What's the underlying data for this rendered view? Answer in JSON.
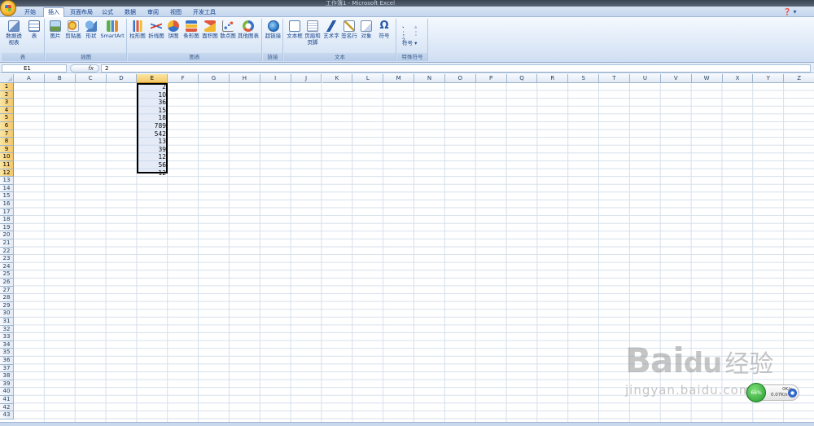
{
  "window": {
    "title": "工作簿1 - Microsoft Excel"
  },
  "tabs": [
    "开始",
    "插入",
    "页面布局",
    "公式",
    "数据",
    "审阅",
    "视图",
    "开发工具"
  ],
  "active_tab": "插入",
  "ribbon": {
    "groups": [
      {
        "label": "表",
        "buttons": [
          "数据透视表",
          "表"
        ]
      },
      {
        "label": "插图",
        "buttons": [
          "图片",
          "剪贴画",
          "形状",
          "SmartArt"
        ]
      },
      {
        "label": "图表",
        "buttons": [
          "柱形图",
          "折线图",
          "饼图",
          "条形图",
          "面积图",
          "散点图",
          "其他图表"
        ]
      },
      {
        "label": "链接",
        "buttons": [
          "超链接"
        ]
      },
      {
        "label": "文本",
        "buttons": [
          "文本框",
          "页眉和页脚",
          "艺术字",
          "签名行",
          "对象",
          "符号"
        ]
      },
      {
        "label": "特殊符号",
        "buttons": [
          "符号"
        ],
        "symbols": "、 。 ；  ： ？"
      }
    ]
  },
  "formula_bar": {
    "name_box": "E1",
    "fx": "fx",
    "formula": "2"
  },
  "columns": [
    "A",
    "B",
    "C",
    "D",
    "E",
    "F",
    "G",
    "H",
    "I",
    "J",
    "K",
    "L",
    "M",
    "N",
    "O",
    "P",
    "Q",
    "R",
    "S",
    "T",
    "U",
    "V",
    "W",
    "X",
    "Y",
    "Z"
  ],
  "selected_column": "E",
  "row_count": 43,
  "selected_rows": [
    1,
    2,
    3,
    4,
    5,
    6,
    7,
    8,
    9,
    10,
    11,
    12
  ],
  "cells": {
    "E": [
      "2",
      "10",
      "36",
      "15",
      "18",
      "789",
      "542",
      "13",
      "39",
      "12",
      "56",
      "12"
    ]
  },
  "watermark": {
    "brand": "Bai",
    "brand_mid": "du",
    "brand_cn": "经验",
    "site": "jingyan.baidu.com"
  },
  "net_widget": {
    "percent": "66%",
    "down": "0K/s",
    "up": "0.07K/s"
  },
  "colors": {
    "selection_border": "#000000",
    "header_selected": "#f4c768",
    "ribbon_bg": "#dbe7f6"
  }
}
